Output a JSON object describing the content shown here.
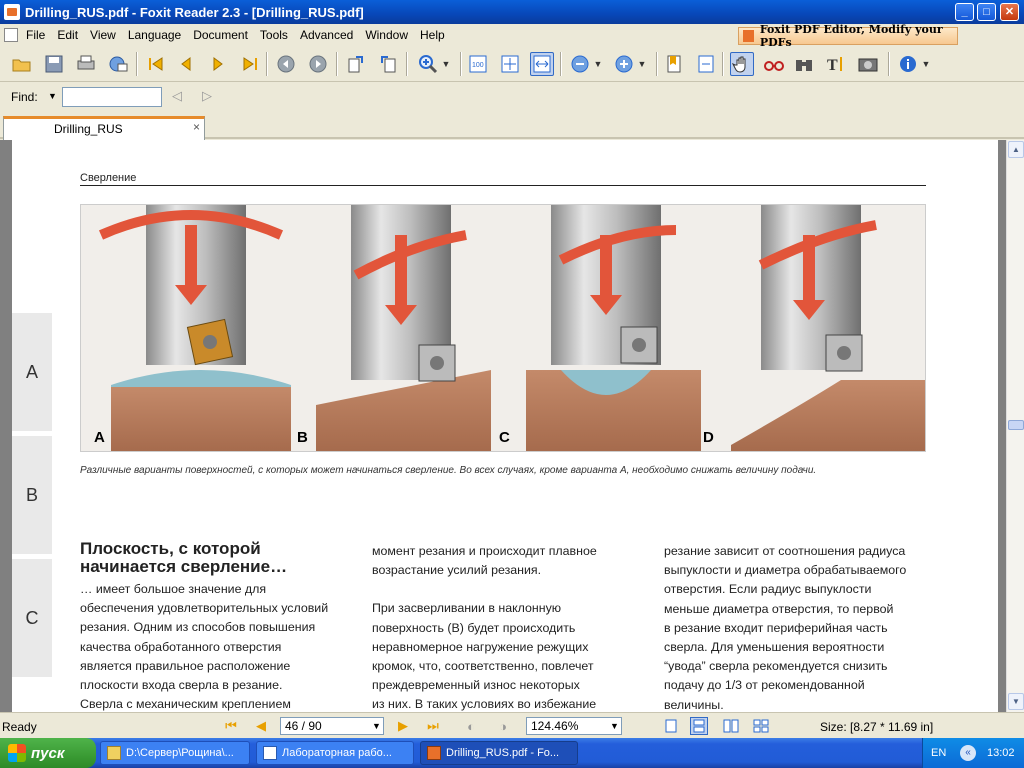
{
  "window": {
    "title": "Drilling_RUS.pdf - Foxit Reader 2.3 - [Drilling_RUS.pdf]",
    "minimize_label": "_",
    "maximize_label": "□",
    "close_label": "✕"
  },
  "menu": {
    "items": [
      "File",
      "Edit",
      "View",
      "Language",
      "Document",
      "Tools",
      "Advanced",
      "Window",
      "Help"
    ],
    "promo": "Foxit PDF Editor, Modify your PDFs"
  },
  "find": {
    "label": "Find:",
    "value": ""
  },
  "tabs": [
    {
      "label": "Drilling_RUS",
      "close": "×"
    }
  ],
  "side_tabs": [
    "A",
    "B",
    "C"
  ],
  "page": {
    "section_label": "Сверление",
    "figure_labels": [
      "A",
      "B",
      "C",
      "D"
    ],
    "caption": "Различные варианты поверхностей, с которых может начинаться сверление. Во всех случаях, кроме варианта А, необходимо снижать величину подачи.",
    "heading_line1": "Плоскость, с которой",
    "heading_line2": "начинается сверление…",
    "col1": [
      "… имеет большое значение для",
      "обеспечения удовлетворительных условий",
      "резания. Одним из способов повышения",
      "качества обработанного отверстия",
      "является правильное расположение",
      "плоскости входа сверла в резание.",
      "Сверла с механическим креплением"
    ],
    "col2": [
      "момент резания и происходит плавное",
      "возрастание усилий резания.",
      "",
      "При засверливании в наклонную",
      "поверхность (B) будет происходить",
      "неравномерное нагружение режущих",
      "кромок, что, соответственно, повлечет",
      "преждевременный износ некоторых",
      "из них. В таких условиях во избежание"
    ],
    "col3": [
      "резание зависит от соотношения радиуса",
      "выпуклости и диаметра обрабатываемого",
      "отверстия. Если радиус выпуклости",
      "меньше диаметра отверстия, то первой",
      "в резание входит периферийная часть",
      "сверла. Для уменьшения вероятности",
      "“увода” сверла рекомендуется снизить",
      "подачу до 1/3 от рекомендованной",
      "величины."
    ]
  },
  "status": {
    "ready": "Ready",
    "page_value": "46 / 90",
    "zoom_value": "124.46%",
    "size": "Size: [8.27 * 11.69 in]"
  },
  "taskbar": {
    "start": "пуск",
    "tasks": [
      "D:\\Сервер\\Рощина\\...",
      "Лабораторная рабо...",
      "Drilling_RUS.pdf - Fo..."
    ],
    "lang": "EN",
    "clock": "13:02"
  },
  "colors": {
    "arrow": "#e2553a",
    "insert": "#c98a2a",
    "workpiece": "#b97a5c",
    "convex": "#8fc0cc"
  }
}
